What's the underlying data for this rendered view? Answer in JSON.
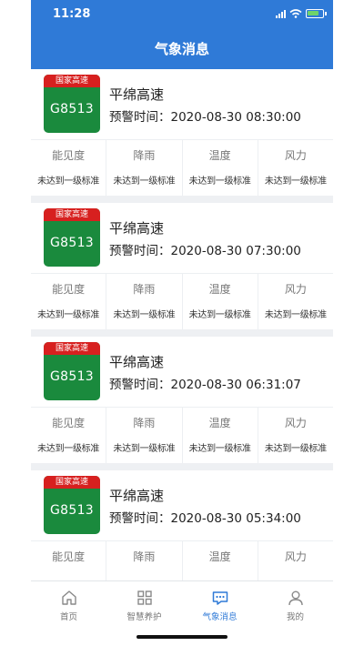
{
  "status": {
    "time": "11:28"
  },
  "header": {
    "title": "气象消息"
  },
  "colors": {
    "primary": "#2f7ad7",
    "sign_red": "#d7201f",
    "sign_green": "#1a8a3d"
  },
  "cards": [
    {
      "sign_type": "国家高速",
      "code": "G8513",
      "road": "平绵高速",
      "warn_label": "预警时间：",
      "warn_time": "2020-08-30 08:30:00",
      "metrics": [
        {
          "label": "能见度",
          "value": "未达到一级标准"
        },
        {
          "label": "降雨",
          "value": "未达到一级标准"
        },
        {
          "label": "温度",
          "value": "未达到一级标准"
        },
        {
          "label": "风力",
          "value": "未达到一级标准"
        }
      ]
    },
    {
      "sign_type": "国家高速",
      "code": "G8513",
      "road": "平绵高速",
      "warn_label": "预警时间：",
      "warn_time": "2020-08-30 07:30:00",
      "metrics": [
        {
          "label": "能见度",
          "value": "未达到一级标准"
        },
        {
          "label": "降雨",
          "value": "未达到一级标准"
        },
        {
          "label": "温度",
          "value": "未达到一级标准"
        },
        {
          "label": "风力",
          "value": "未达到一级标准"
        }
      ]
    },
    {
      "sign_type": "国家高速",
      "code": "G8513",
      "road": "平绵高速",
      "warn_label": "预警时间：",
      "warn_time": "2020-08-30 06:31:07",
      "metrics": [
        {
          "label": "能见度",
          "value": "未达到一级标准"
        },
        {
          "label": "降雨",
          "value": "未达到一级标准"
        },
        {
          "label": "温度",
          "value": "未达到一级标准"
        },
        {
          "label": "风力",
          "value": "未达到一级标准"
        }
      ]
    },
    {
      "sign_type": "国家高速",
      "code": "G8513",
      "road": "平绵高速",
      "warn_label": "预警时间：",
      "warn_time": "2020-08-30 05:34:00",
      "metrics": [
        {
          "label": "能见度"
        },
        {
          "label": "降雨"
        },
        {
          "label": "温度"
        },
        {
          "label": "风力"
        }
      ]
    }
  ],
  "tabbar": [
    {
      "label": "首页",
      "icon": "home-icon"
    },
    {
      "label": "智慧养护",
      "icon": "grid-icon"
    },
    {
      "label": "气象消息",
      "icon": "message-icon",
      "active": true
    },
    {
      "label": "我的",
      "icon": "user-icon"
    }
  ]
}
